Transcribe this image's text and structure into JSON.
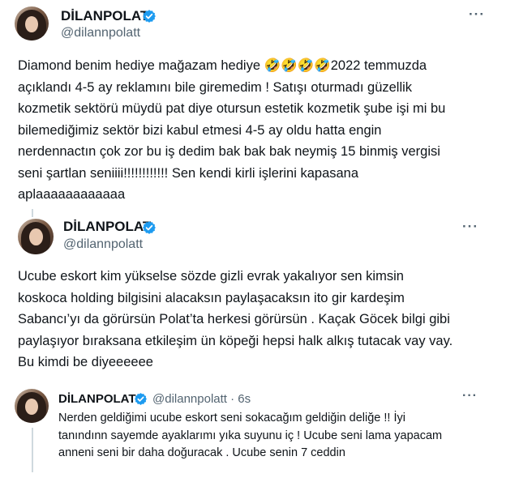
{
  "tweets": [
    {
      "display_name": "DİLANPOLAT",
      "handle": "@dilannpolatt",
      "more": "···",
      "text": "Diamond benim hediye mağazam hediye 🤣🤣🤣🤣2022 temmuzda\naçıklandı 4-5 ay reklamını bile giremedim ! Satışı oturmadı güzellik\nkozmetik sektörü müydü pat diye otursun estetik kozmetik şube işi mi bu\nbilemediğimiz sektör bizi kabul etmesi 4-5 ay oldu hatta engin\nnerdennactın çok zor bu iş dedim bak bak bak neymiş 15 binmiş vergisi\nseni şartlan seniiii!!!!!!!!!!!! Sen kendi kirli işlerini kapasana\naplaaaaaaaaaaaa"
    },
    {
      "display_name": "DİLANPOLAT",
      "handle": "@dilannpolatt",
      "more": "···",
      "text": "Ucube eskort kim yükselse sözde gizli evrak yakalıyor sen kimsin\nkoskoca holding bilgisini alacaksın paylaşacaksın ito gir kardeşim\nSabancı’yı da görürsün Polat’ta herkesi görürsün . Kaçak Göcek bilgi gibi\npaylaşıyor bıraksana etkileşim ün köpeği hepsi halk alkış tutacak vay vay.\nBu kimdi be diyeeeeee"
    },
    {
      "display_name": "DİLANPOLAT",
      "handle": "@dilannpolatt · 6s",
      "more": "···",
      "text": "Nerden geldiğimi ucube eskort seni sokacağım geldiğin deliğe !! İyi\ntanındınn sayemde ayaklarımı yıka suyunu iç ! Ucube seni lama yapacam\nanneni seni bir daha doğuracak . Ucube senin 7 ceddin"
    }
  ],
  "colors": {
    "verified": "#1d9bf0",
    "text": "#0f1419",
    "secondary": "#536471",
    "thread_line": "#cfd9de"
  },
  "icons": {
    "verified": "verified-badge-icon",
    "more": "more-options-icon"
  }
}
